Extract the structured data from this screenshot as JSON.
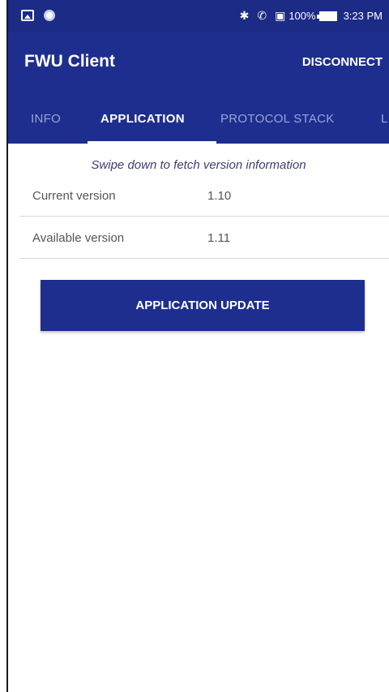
{
  "status_bar": {
    "battery_percent": "100%",
    "time": "3:23 PM",
    "icons": [
      "image-icon",
      "record-icon",
      "bluetooth-icon",
      "phone-icon",
      "sim-icon",
      "battery-icon"
    ]
  },
  "app_bar": {
    "title": "FWU Client",
    "disconnect_label": "DISCONNECT"
  },
  "tabs": [
    {
      "label": "INFO",
      "active": false
    },
    {
      "label": "APPLICATION",
      "active": true
    },
    {
      "label": "PROTOCOL STACK",
      "active": false
    },
    {
      "label": "L",
      "active": false
    }
  ],
  "content": {
    "hint": "Swipe down to fetch version information",
    "rows": [
      {
        "label": "Current version",
        "value": "1.10"
      },
      {
        "label": "Available version",
        "value": "1.11"
      }
    ],
    "update_button_label": "APPLICATION UPDATE"
  },
  "colors": {
    "primary": "#1e2e8f",
    "status_bar": "#1c2b86",
    "tab_inactive": "#9aa3d8"
  }
}
